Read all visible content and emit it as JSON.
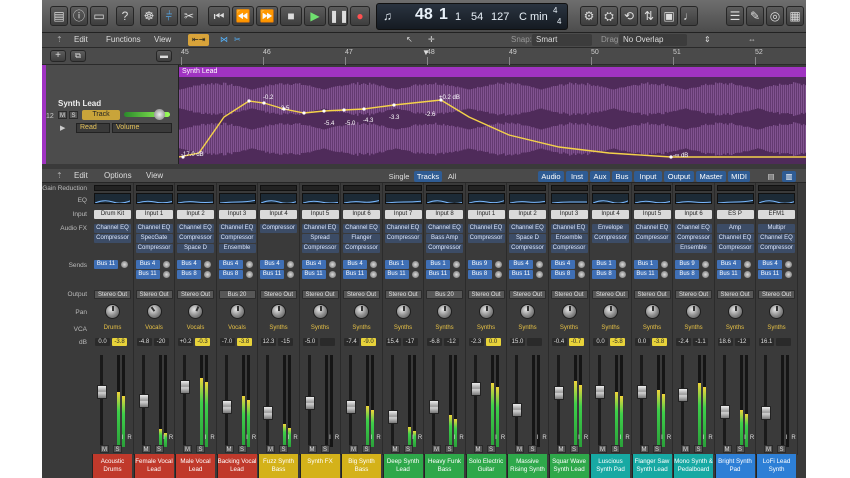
{
  "transport": {
    "bar": "48",
    "beat": "1",
    "sub": "1",
    "tempo": "54",
    "bpm": "127",
    "key": "C min",
    "sig_top": "4",
    "sig_bot": "4"
  },
  "arrange": {
    "menus": [
      "Edit",
      "Functions",
      "View"
    ],
    "snap_label": "Snap:",
    "snap_value": "Smart",
    "drag_label": "Drag:",
    "drag_value": "No Overlap",
    "ruler": [
      "45",
      "46",
      "47",
      "48",
      "49",
      "50",
      "51",
      "52"
    ],
    "track": {
      "number": "12",
      "name": "Synth Lead",
      "m": "M",
      "s": "S",
      "track_btn": "Track",
      "read": "Read",
      "param": "Volume"
    },
    "region_name": "Synth Lead",
    "automation": {
      "start_label": "-17.0 dB",
      "peak_label": "+0.2 dB",
      "end_label": "-∞ dB",
      "points": [
        "-0.2",
        "-3.5",
        "-5.4",
        "-5.0",
        "-4.3",
        "-3.3",
        "-2.6"
      ]
    }
  },
  "mixer": {
    "menus": [
      "Edit",
      "Options",
      "View"
    ],
    "modes": [
      "Single",
      "Tracks",
      "All"
    ],
    "filters": [
      "Audio",
      "Inst",
      "Aux",
      "Bus",
      "Input",
      "Output",
      "Master",
      "MIDI"
    ],
    "row_labels": [
      "Gain Reduction",
      "EQ",
      "Input",
      "Audio FX",
      "Sends",
      "Output",
      "Pan",
      "VCA",
      "dB"
    ],
    "channels": [
      {
        "name": "Acoustic Drums",
        "color": "#c0392b",
        "input": "Drum Kit",
        "fx": [
          "Channel EQ",
          "Compressor"
        ],
        "sends": [
          "Bus 11"
        ],
        "output": "Stereo Out",
        "group": "Drums",
        "db1": "0.0",
        "db2": "-3.8",
        "pan": 0,
        "fader": 0.62,
        "meter": 0.6
      },
      {
        "name": "Female Vocal Lead",
        "color": "#c0392b",
        "input": "Input 1",
        "fx": [
          "Channel EQ",
          "SpecGate",
          "Compressor"
        ],
        "sends": [
          "Bus 4",
          "Bus 11"
        ],
        "output": "Stereo Out",
        "group": "Vocals",
        "db1": "-4.8",
        "db2": "-20",
        "pan": -0.3,
        "fader": 0.5,
        "meter": 0.2
      },
      {
        "name": "Male Vocal Lead",
        "color": "#c0392b",
        "input": "Input 2",
        "fx": [
          "Channel EQ",
          "Compressor",
          "Space D"
        ],
        "sends": [
          "Bus 4",
          "Bus 8"
        ],
        "output": "Stereo Out",
        "group": "Vocals",
        "db1": "+0.2",
        "db2": "-0.3",
        "pan": 0.2,
        "fader": 0.68,
        "meter": 0.75
      },
      {
        "name": "Backing Vocal Lead",
        "color": "#c0392b",
        "input": "Input 3",
        "fx": [
          "Channel EQ",
          "Compressor",
          "Ensemble"
        ],
        "sends": [
          "Bus 4",
          "Bus 8"
        ],
        "output": "Bus 20",
        "group": "Vocals",
        "db1": "-7.0",
        "db2": "-3.8",
        "pan": 0,
        "fader": 0.42,
        "meter": 0.55
      },
      {
        "name": "Fuzz Synth Bass",
        "color": "#d4b21a",
        "input": "Input 4",
        "fx": [
          "Compressor"
        ],
        "sends": [
          "Bus 4",
          "Bus 11"
        ],
        "output": "Stereo Out",
        "group": "Synths",
        "db1": "12.3",
        "db2": "-15",
        "pan": 0,
        "fader": 0.35,
        "meter": 0.25
      },
      {
        "name": "Synth FX",
        "color": "#d4b21a",
        "input": "Input 5",
        "fx": [
          "Channel EQ",
          "Spread",
          "Compressor"
        ],
        "sends": [
          "Bus 4",
          "Bus 11"
        ],
        "output": "Stereo Out",
        "group": "Synths",
        "db1": "-5.0",
        "db2": "",
        "pan": 0,
        "fader": 0.48,
        "meter": 0.0
      },
      {
        "name": "Big Synth Bass",
        "color": "#d4b21a",
        "input": "Input 6",
        "fx": [
          "Channel EQ",
          "Flanger",
          "Compressor"
        ],
        "sends": [
          "Bus 4",
          "Bus 11"
        ],
        "output": "Stereo Out",
        "group": "Synths",
        "db1": "-7.4",
        "db2": "-9.0",
        "pan": 0,
        "fader": 0.42,
        "meter": 0.45
      },
      {
        "name": "Deep Synth Lead",
        "color": "#2ea84a",
        "input": "Input 7",
        "fx": [
          "Channel EQ",
          "Compressor"
        ],
        "sends": [
          "Bus 1",
          "Bus 11"
        ],
        "output": "Stereo Out",
        "group": "Synths",
        "db1": "15.4",
        "db2": "-17",
        "pan": 0,
        "fader": 0.3,
        "meter": 0.22
      },
      {
        "name": "Heavy Funk Bass",
        "color": "#2ea84a",
        "input": "Input 8",
        "fx": [
          "Channel EQ",
          "Bass Amp",
          "Compressor"
        ],
        "sends": [
          "Bus 1",
          "Bus 11"
        ],
        "output": "Bus 20",
        "group": "Synths",
        "db1": "-6.8",
        "db2": "-12",
        "pan": 0,
        "fader": 0.42,
        "meter": 0.35
      },
      {
        "name": "Solo Electric Guitar",
        "color": "#2ea84a",
        "input": "Input 1",
        "fx": [
          "Channel EQ",
          "Compressor"
        ],
        "sends": [
          "Bus 9",
          "Bus 8"
        ],
        "output": "Stereo Out",
        "group": "Synths",
        "db1": "-2.3",
        "db2": "0.0",
        "pan": 0,
        "fader": 0.66,
        "meter": 0.7
      },
      {
        "name": "Massive Rising Synth",
        "color": "#2ea84a",
        "input": "Input 2",
        "fx": [
          "Channel EQ",
          "Space D",
          "Compressor"
        ],
        "sends": [
          "Bus 4",
          "Bus 11"
        ],
        "output": "Stereo Out",
        "group": "Synths",
        "db1": "15.0",
        "db2": "",
        "pan": 0,
        "fader": 0.38,
        "meter": 0.0
      },
      {
        "name": "Squar Wave Synth Lead",
        "color": "#2ea84a",
        "input": "Input 3",
        "fx": [
          "Channel EQ",
          "Ensemble",
          "Compressor"
        ],
        "sends": [
          "Bus 4",
          "Bus 8"
        ],
        "output": "Stereo Out",
        "group": "Synths",
        "db1": "-0.4",
        "db2": "-0.7",
        "pan": 0,
        "fader": 0.6,
        "meter": 0.72
      },
      {
        "name": "Luscious Synth Pad",
        "color": "#17a9a3",
        "input": "Input 4",
        "fx": [
          "Envelope",
          "Compressor"
        ],
        "sends": [
          "Bus 1",
          "Bus 8"
        ],
        "output": "Stereo Out",
        "group": "Synths",
        "db1": "0.0",
        "db2": "-5.8",
        "pan": 0,
        "fader": 0.62,
        "meter": 0.6
      },
      {
        "name": "Flanger Saw Synth Lead",
        "color": "#17a9a3",
        "input": "Input 5",
        "fx": [
          "Channel EQ",
          "Compressor"
        ],
        "sends": [
          "Bus 1",
          "Bus 11"
        ],
        "output": "Stereo Out",
        "group": "Synths",
        "db1": "0.0",
        "db2": "-3.8",
        "pan": 0,
        "fader": 0.62,
        "meter": 0.62
      },
      {
        "name": "Mono Synth & Pedalboard",
        "color": "#17a9a3",
        "input": "Input 6",
        "fx": [
          "Channel EQ",
          "Compressor",
          "Ensemble"
        ],
        "sends": [
          "Bus 9",
          "Bus 8"
        ],
        "output": "Stereo Out",
        "group": "Synths",
        "db1": "-2.4",
        "db2": "-1.1",
        "pan": 0,
        "fader": 0.58,
        "meter": 0.7
      },
      {
        "name": "Bright Synth Pad",
        "color": "#2d7fd6",
        "input": "ES P",
        "fx": [
          "Amp",
          "Channel EQ",
          "Compressor"
        ],
        "sends": [
          "Bus 4",
          "Bus 11"
        ],
        "output": "Stereo Out",
        "group": "Synths",
        "db1": "18.6",
        "db2": "-12",
        "pan": 0,
        "fader": 0.36,
        "meter": 0.4
      },
      {
        "name": "LoFi Lead Synth",
        "color": "#2d7fd6",
        "input": "EFM1",
        "fx": [
          "Multipr",
          "Channel EQ",
          "Compressor"
        ],
        "sends": [
          "Bus 4",
          "Bus 11"
        ],
        "output": "Stereo Out",
        "group": "Synths",
        "db1": "16.1",
        "db2": "",
        "pan": 0,
        "fader": 0.34,
        "meter": 0.0
      }
    ],
    "ms": [
      "M",
      "S"
    ],
    "ir": [
      "I",
      "R"
    ]
  }
}
